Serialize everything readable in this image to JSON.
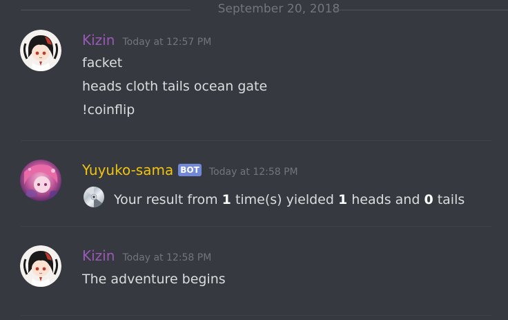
{
  "date_divider": {
    "text": "September 20, 2018"
  },
  "messages": [
    {
      "author": "Kizin",
      "timestamp": "Today at 12:57 PM",
      "lines": [
        "facket",
        "heads cloth tails ocean gate",
        "!coinflip"
      ]
    },
    {
      "author": "Yuyuko-sama",
      "bot_tag": "BOT",
      "timestamp": "Today at 12:58 PM",
      "result": {
        "prefix": "Your result from",
        "times": "1",
        "middle": "time(s) yielded",
        "heads": "1",
        "heads_label": "heads and",
        "tails": "0",
        "tails_label": "tails"
      },
      "icon": "disc-icon"
    },
    {
      "author": "Kizin",
      "timestamp": "Today at 12:58 PM",
      "lines": [
        "The adventure begins"
      ]
    }
  ],
  "colors": {
    "background": "#36393f",
    "kizin_name": "#9b59b6",
    "yuyuko_name": "#f1c40f",
    "bot_tag": "#7289da",
    "timestamp": "#72767d"
  }
}
